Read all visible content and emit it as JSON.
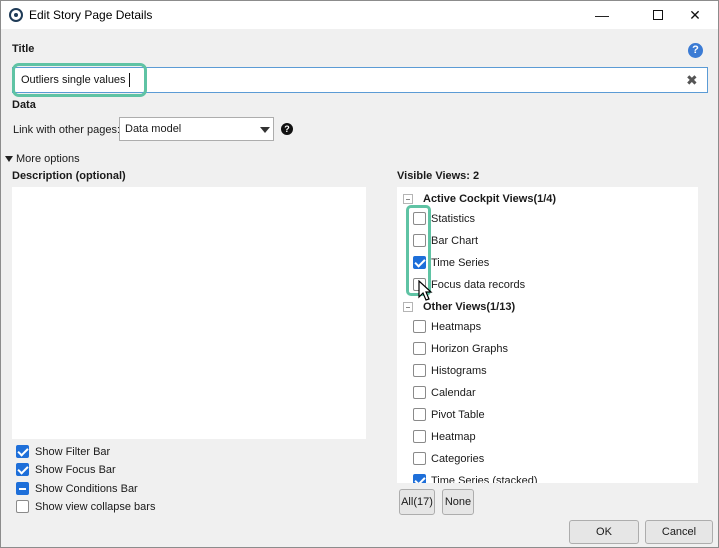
{
  "window": {
    "title": "Edit Story Page Details",
    "controls": {
      "minimize": "—",
      "close": "✕"
    }
  },
  "title_section": {
    "label": "Title",
    "input_value": "Outliers single values",
    "help": "?"
  },
  "data_section": {
    "label": "Data",
    "link_label": "Link with other pages:",
    "link_value": "Data model",
    "help": "?"
  },
  "more_options": {
    "label": "More options"
  },
  "description": {
    "label": "Description (optional)"
  },
  "bars": [
    {
      "label": "Show Filter Bar",
      "state": "checked"
    },
    {
      "label": "Show Focus Bar",
      "state": "checked"
    },
    {
      "label": "Show Conditions Bar",
      "state": "indeterminate"
    },
    {
      "label": "Show view collapse bars",
      "state": "unchecked"
    }
  ],
  "views": {
    "header": "Visible Views: 2",
    "active_group": {
      "label": "Active Cockpit Views(1/4)",
      "items": [
        {
          "label": "Statistics",
          "checked": false
        },
        {
          "label": "Bar Chart",
          "checked": false
        },
        {
          "label": "Time Series",
          "checked": true
        },
        {
          "label": "Focus data records",
          "checked": false
        }
      ]
    },
    "other_group": {
      "label": "Other Views(1/13)",
      "items": [
        {
          "label": "Heatmaps",
          "checked": false
        },
        {
          "label": "Horizon Graphs",
          "checked": false
        },
        {
          "label": "Histograms",
          "checked": false
        },
        {
          "label": "Calendar",
          "checked": false
        },
        {
          "label": "Pivot Table",
          "checked": false
        },
        {
          "label": "Heatmap",
          "checked": false
        },
        {
          "label": "Categories",
          "checked": false
        },
        {
          "label": "Time Series (stacked)",
          "checked": true
        }
      ]
    },
    "all_button": "All(17)",
    "none_button": "None"
  },
  "footer": {
    "ok": "OK",
    "cancel": "Cancel"
  },
  "colors": {
    "accent": "#1e6fd9",
    "highlight": "#5fc3a4",
    "help": "#3b7bd4"
  }
}
